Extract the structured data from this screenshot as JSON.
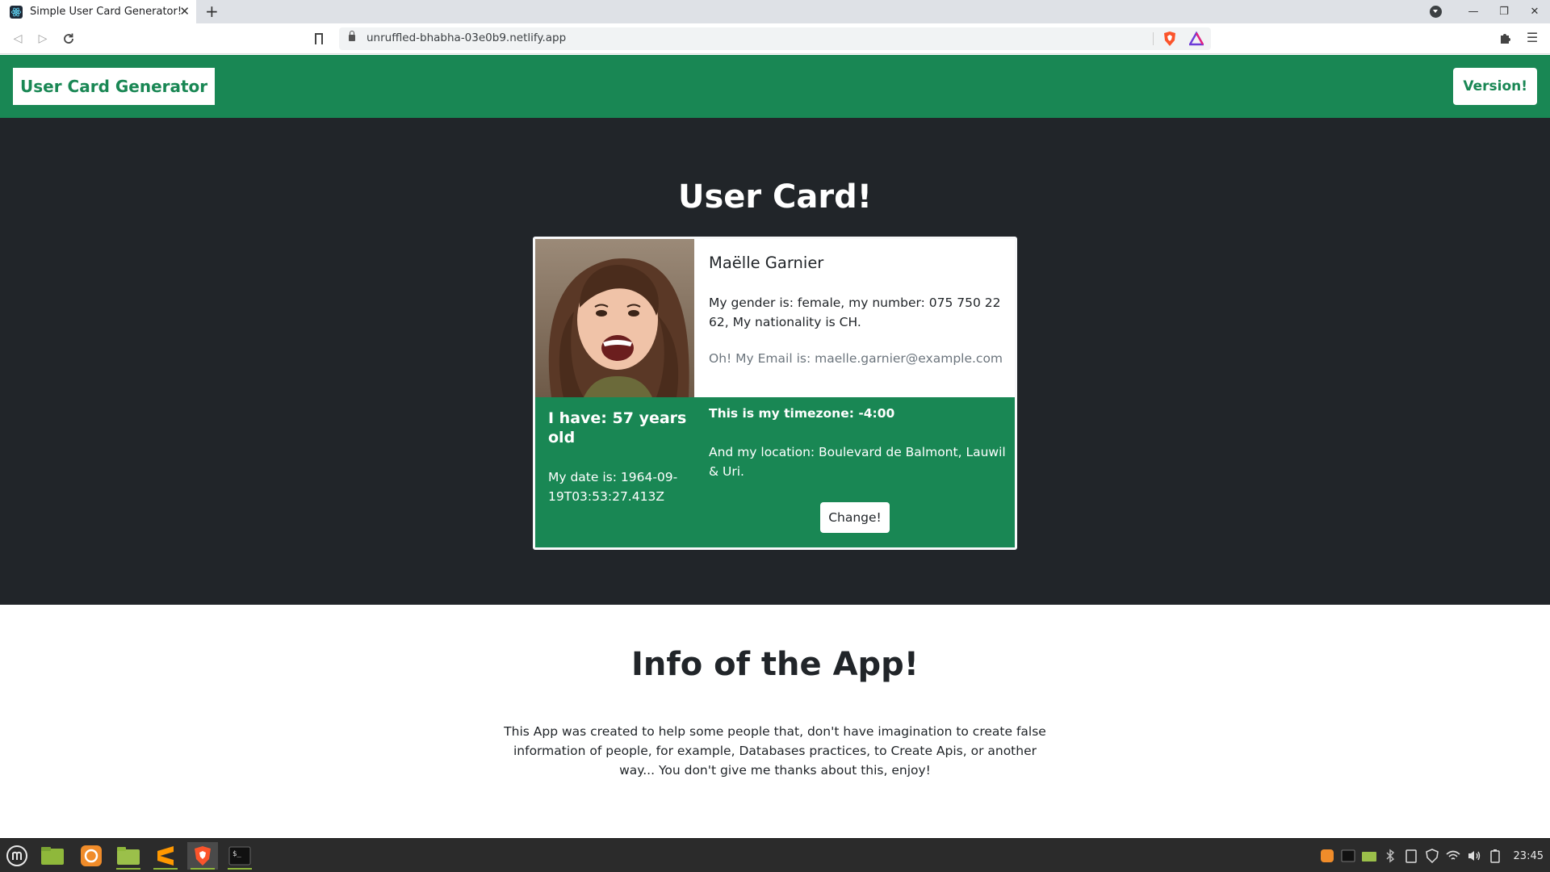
{
  "browser": {
    "tab_title": "Simple User Card Generator!",
    "new_tab_symbol": "+",
    "url": "unruffled-bhabha-03e0b9.netlify.app"
  },
  "navbar": {
    "brand": "User Card Generator",
    "version_button": "Version!"
  },
  "hero": {
    "title": "User Card!"
  },
  "user_card": {
    "name": "Maëlle Garnier",
    "info": "My gender is: female, my number: 075 750 22 62, My nationality is CH.",
    "email": "Oh! My Email is: maelle.garnier@example.com",
    "age": "I have: 57 years old",
    "date": "My date is: 1964-09-19T03:53:27.413Z",
    "timezone": "This is my timezone: -4:00",
    "location": "And my location: Boulevard de Balmont, Lauwil & Uri.",
    "change_button": "Change!"
  },
  "info_section": {
    "title": "Info of the App!",
    "text": "This App was created to help some people that, don't have imagination to create false information of people, for example, Databases practices, to Create Apis, or another way... You don't give me thanks about this, enjoy!"
  },
  "taskbar": {
    "clock": "23:45",
    "apps": [
      "mint-menu-icon",
      "files-green-icon",
      "firefox-icon",
      "folder-icon",
      "sublime-text-icon",
      "brave-icon",
      "terminal-icon"
    ]
  },
  "colors": {
    "brand_green": "#198754",
    "hero_dark": "#212529"
  }
}
